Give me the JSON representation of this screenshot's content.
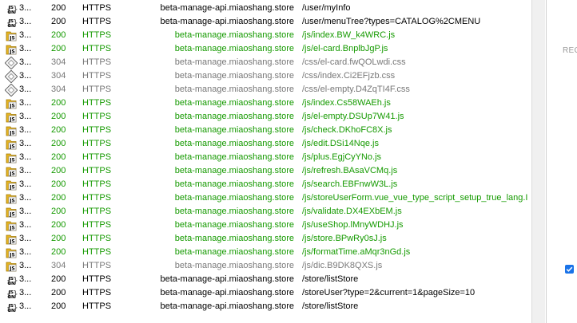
{
  "sessions": [
    {
      "id": "3...",
      "result": "200",
      "protocol": "HTTPS",
      "host": "beta-manage-api.miaoshang.store",
      "url": "/user/myInfo",
      "type": "api",
      "style": "ok"
    },
    {
      "id": "3...",
      "result": "200",
      "protocol": "HTTPS",
      "host": "beta-manage-api.miaoshang.store",
      "url": "/user/menuTree?types=CATALOG%2CMENU",
      "type": "api",
      "style": "ok"
    },
    {
      "id": "3...",
      "result": "200",
      "protocol": "HTTPS",
      "host": "beta-manage.miaoshang.store",
      "url": "/js/index.BW_k4WRC.js",
      "type": "js",
      "style": "js"
    },
    {
      "id": "3...",
      "result": "200",
      "protocol": "HTTPS",
      "host": "beta-manage.miaoshang.store",
      "url": "/js/el-card.BnplbJgP.js",
      "type": "js",
      "style": "js"
    },
    {
      "id": "3...",
      "result": "304",
      "protocol": "HTTPS",
      "host": "beta-manage.miaoshang.store",
      "url": "/css/el-card.fwQOLwdi.css",
      "type": "css",
      "style": "css"
    },
    {
      "id": "3...",
      "result": "304",
      "protocol": "HTTPS",
      "host": "beta-manage.miaoshang.store",
      "url": "/css/index.Ci2EFjzb.css",
      "type": "css",
      "style": "css"
    },
    {
      "id": "3...",
      "result": "304",
      "protocol": "HTTPS",
      "host": "beta-manage.miaoshang.store",
      "url": "/css/el-empty.D4ZqTI4F.css",
      "type": "css",
      "style": "css"
    },
    {
      "id": "3...",
      "result": "200",
      "protocol": "HTTPS",
      "host": "beta-manage.miaoshang.store",
      "url": "/js/index.Cs58WAEh.js",
      "type": "js",
      "style": "js"
    },
    {
      "id": "3...",
      "result": "200",
      "protocol": "HTTPS",
      "host": "beta-manage.miaoshang.store",
      "url": "/js/el-empty.DSUp7W41.js",
      "type": "js",
      "style": "js"
    },
    {
      "id": "3...",
      "result": "200",
      "protocol": "HTTPS",
      "host": "beta-manage.miaoshang.store",
      "url": "/js/check.DKhoFC8X.js",
      "type": "js",
      "style": "js"
    },
    {
      "id": "3...",
      "result": "200",
      "protocol": "HTTPS",
      "host": "beta-manage.miaoshang.store",
      "url": "/js/edit.DSi14Nqe.js",
      "type": "js",
      "style": "js"
    },
    {
      "id": "3...",
      "result": "200",
      "protocol": "HTTPS",
      "host": "beta-manage.miaoshang.store",
      "url": "/js/plus.EgjCyYNo.js",
      "type": "js",
      "style": "js"
    },
    {
      "id": "3...",
      "result": "200",
      "protocol": "HTTPS",
      "host": "beta-manage.miaoshang.store",
      "url": "/js/refresh.BAsaVCMq.js",
      "type": "js",
      "style": "js"
    },
    {
      "id": "3...",
      "result": "200",
      "protocol": "HTTPS",
      "host": "beta-manage.miaoshang.store",
      "url": "/js/search.EBFnwW3L.js",
      "type": "js",
      "style": "js"
    },
    {
      "id": "3...",
      "result": "200",
      "protocol": "HTTPS",
      "host": "beta-manage.miaoshang.store",
      "url": "/js/storeUserForm.vue_vue_type_script_setup_true_lang.I",
      "type": "js",
      "style": "js"
    },
    {
      "id": "3...",
      "result": "200",
      "protocol": "HTTPS",
      "host": "beta-manage.miaoshang.store",
      "url": "/js/validate.DX4EXbEM.js",
      "type": "js",
      "style": "js"
    },
    {
      "id": "3...",
      "result": "200",
      "protocol": "HTTPS",
      "host": "beta-manage.miaoshang.store",
      "url": "/js/useShop.lMnyWDHJ.js",
      "type": "js",
      "style": "js"
    },
    {
      "id": "3...",
      "result": "200",
      "protocol": "HTTPS",
      "host": "beta-manage.miaoshang.store",
      "url": "/js/store.BPwRy0sJ.js",
      "type": "js",
      "style": "js"
    },
    {
      "id": "3...",
      "result": "200",
      "protocol": "HTTPS",
      "host": "beta-manage.miaoshang.store",
      "url": "/js/formatTime.aMqr3nGd.js",
      "type": "js",
      "style": "js"
    },
    {
      "id": "3...",
      "result": "304",
      "protocol": "HTTPS",
      "host": "beta-manage.miaoshang.store",
      "url": "/js/dic.B9DK8QXS.js",
      "type": "js",
      "style": "dim"
    },
    {
      "id": "3...",
      "result": "200",
      "protocol": "HTTPS",
      "host": "beta-manage-api.miaoshang.store",
      "url": "/store/listStore",
      "type": "api",
      "style": "ok"
    },
    {
      "id": "3...",
      "result": "200",
      "protocol": "HTTPS",
      "host": "beta-manage-api.miaoshang.store",
      "url": "/storeUser?type=2&current=1&pageSize=10",
      "type": "api",
      "style": "ok"
    },
    {
      "id": "3...",
      "result": "200",
      "protocol": "HTTPS",
      "host": "beta-manage-api.miaoshang.store",
      "url": "/store/listStore",
      "type": "api",
      "style": "ok"
    }
  ],
  "right_panel": {
    "label": "REC",
    "checkbox_checked": true
  },
  "colors": {
    "js_text": "#159a00",
    "css_text": "#777777",
    "default_text": "#000000",
    "checkbox": "#1a73e8"
  },
  "icons": {
    "api": "json-brace-icon",
    "js": "javascript-file-icon",
    "css": "css-file-icon"
  }
}
